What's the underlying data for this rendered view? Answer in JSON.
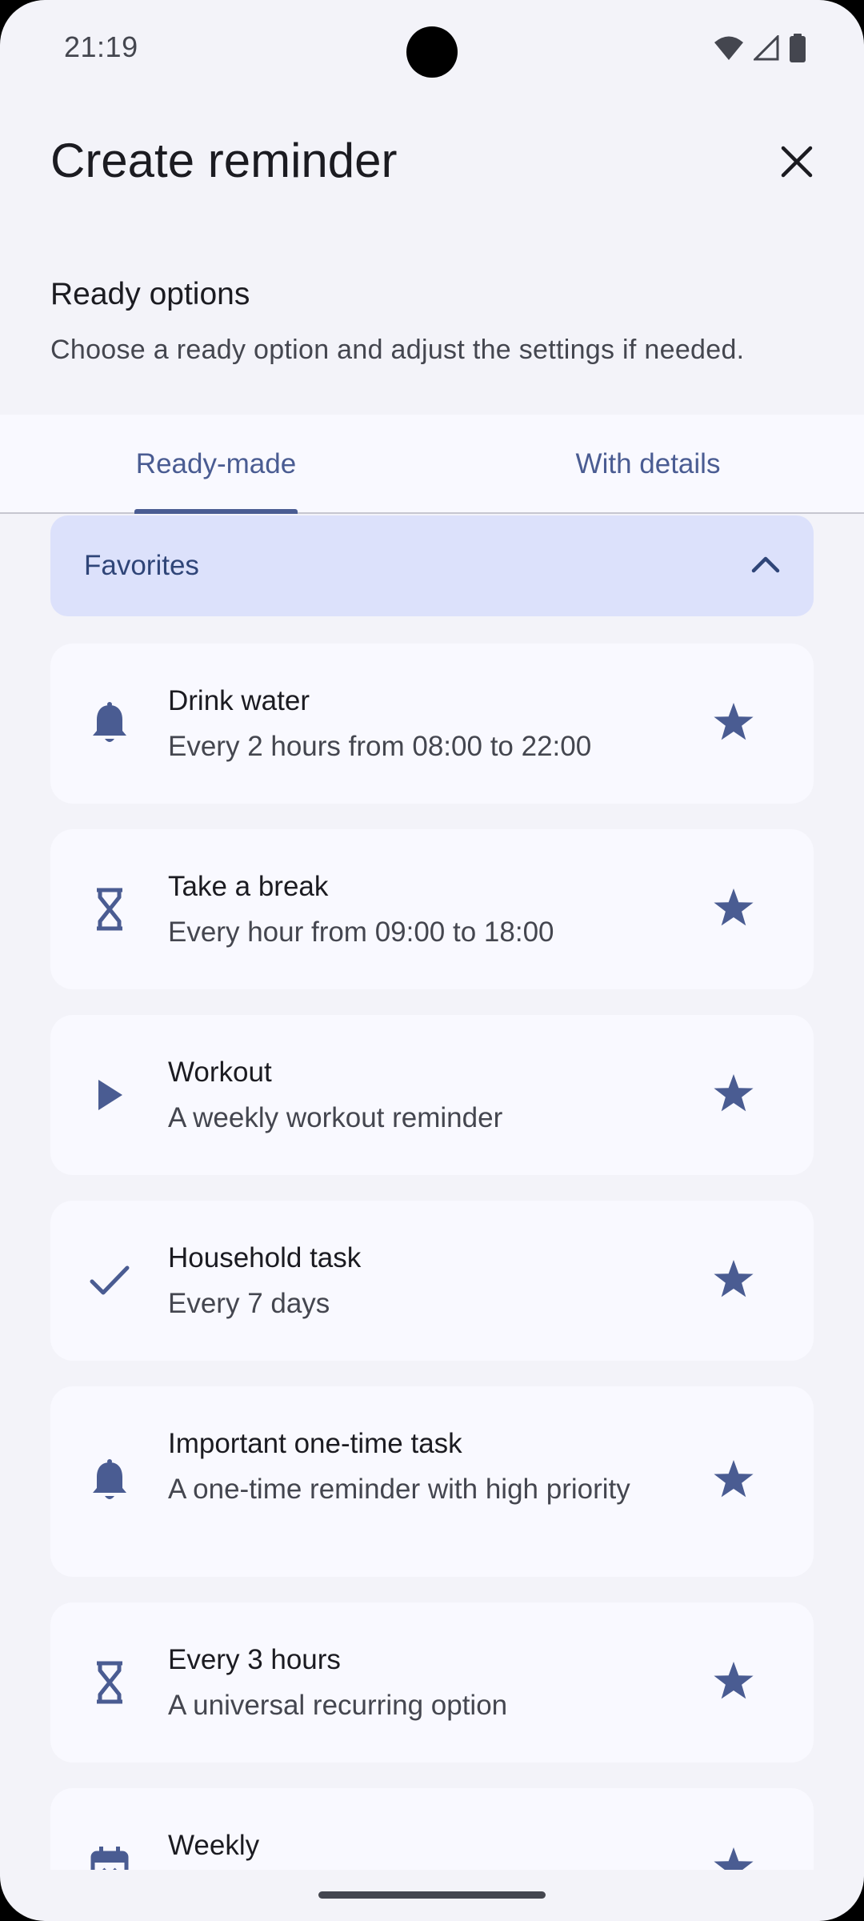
{
  "status": {
    "time": "21:19"
  },
  "header": {
    "title": "Create reminder"
  },
  "section": {
    "title": "Ready options",
    "subtitle": "Choose a ready option and adjust the settings if needed."
  },
  "tabs": [
    {
      "label": "Ready-made",
      "selected": true
    },
    {
      "label": "With details",
      "selected": false
    }
  ],
  "favorites": {
    "label": "Favorites",
    "expanded": true
  },
  "items": [
    {
      "icon": "bell-icon",
      "title": "Drink water",
      "subtitle": "Every 2 hours from 08:00 to 22:00",
      "favorite": true
    },
    {
      "icon": "hourglass-icon",
      "title": "Take a break",
      "subtitle": "Every hour from 09:00 to 18:00",
      "favorite": true
    },
    {
      "icon": "play-icon",
      "title": "Workout",
      "subtitle": "A weekly workout reminder",
      "favorite": true
    },
    {
      "icon": "check-icon",
      "title": "Household task",
      "subtitle": "Every 7 days",
      "favorite": true
    },
    {
      "icon": "bell-icon",
      "title": "Important one-time task",
      "subtitle": "A one-time reminder with high priority",
      "favorite": true
    },
    {
      "icon": "hourglass-icon",
      "title": "Every 3 hours",
      "subtitle": "A universal recurring option",
      "favorite": true
    },
    {
      "icon": "calendar-icon",
      "title": "Weekly",
      "subtitle": "",
      "favorite": true
    }
  ],
  "colors": {
    "accent": "#4a5c92",
    "background": "#f3f3f9",
    "card": "#f9f9ff",
    "favorites_bg": "#dce1fb"
  }
}
